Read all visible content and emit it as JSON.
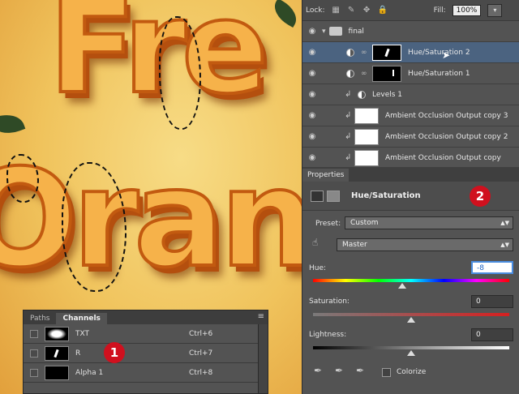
{
  "layers_panel": {
    "lock_label": "Lock:",
    "fill_label": "Fill:",
    "fill_value": "100%",
    "group_name": "final",
    "layers": [
      {
        "name": "Hue/Saturation 2",
        "selected": true
      },
      {
        "name": "Hue/Saturation 1",
        "selected": false
      },
      {
        "name": "Levels 1",
        "selected": false
      },
      {
        "name": "Ambient Occlusion Output copy 3",
        "selected": false
      },
      {
        "name": "Ambient Occlusion Output copy 2",
        "selected": false
      },
      {
        "name": "Ambient Occlusion Output copy",
        "selected": false
      }
    ]
  },
  "properties_panel": {
    "tab": "Properties",
    "title": "Hue/Saturation",
    "badge": "2",
    "preset_label": "Preset:",
    "preset_value": "Custom",
    "range_value": "Master",
    "hue_label": "Hue:",
    "hue_value": "-8",
    "saturation_label": "Saturation:",
    "saturation_value": "0",
    "lightness_label": "Lightness:",
    "lightness_value": "0",
    "colorize_label": "Colorize"
  },
  "channels_panel": {
    "tabs": [
      "Paths",
      "Channels"
    ],
    "active_tab": "Channels",
    "badge": "1",
    "channels": [
      {
        "name": "TXT",
        "shortcut": "Ctrl+6"
      },
      {
        "name": "R",
        "shortcut": "Ctrl+7"
      },
      {
        "name": "Alpha 1",
        "shortcut": "Ctrl+8"
      }
    ]
  },
  "canvas": {
    "line1": "Fre",
    "line2": "Oran"
  },
  "colors": {
    "selected_layer": "#4b6380",
    "badge": "#d0101e",
    "panel_bg": "#535353",
    "orange_accent": "#f6b24a"
  },
  "icons": {
    "eye": "eye-icon",
    "folder": "folder-icon",
    "chain": "chain-link-icon",
    "clip": "clipping-arrow-icon",
    "targeted_adjust": "hand-adjust-icon",
    "eyedropper": "eyedropper-icon"
  }
}
